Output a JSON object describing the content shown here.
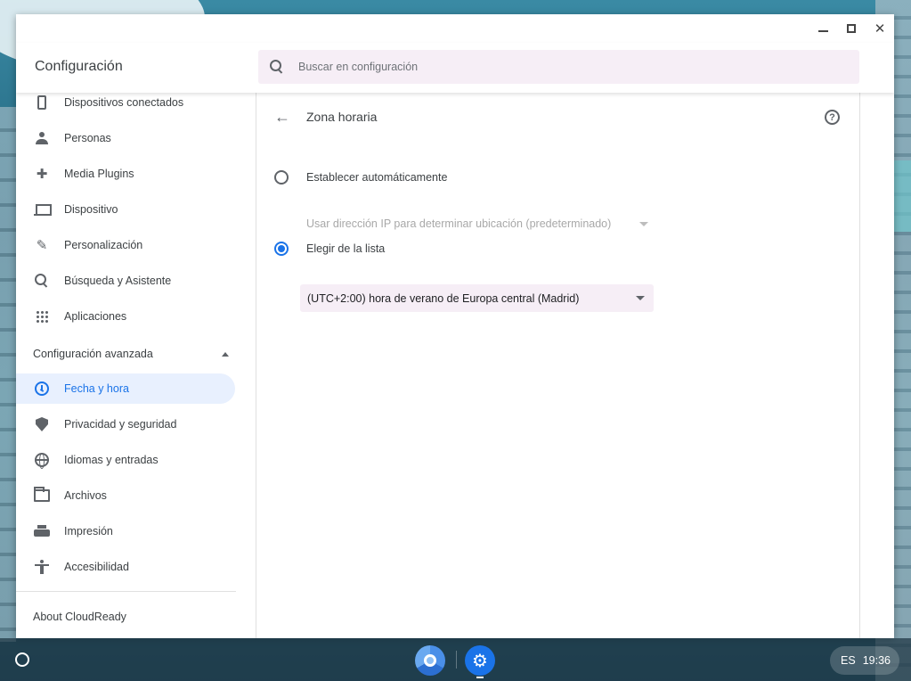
{
  "window": {
    "title": "Configuración",
    "search_placeholder": "Buscar en configuración"
  },
  "sidebar": {
    "items": [
      {
        "label": "Dispositivos conectados",
        "icon": "phone-icon"
      },
      {
        "label": "Personas",
        "icon": "person-icon"
      },
      {
        "label": "Media Plugins",
        "icon": "puzzle-icon"
      },
      {
        "label": "Dispositivo",
        "icon": "laptop-icon"
      },
      {
        "label": "Personalización",
        "icon": "brush-icon"
      },
      {
        "label": "Búsqueda y Asistente",
        "icon": "search-icon"
      },
      {
        "label": "Aplicaciones",
        "icon": "apps-grid-icon"
      }
    ],
    "advanced_label": "Configuración avanzada",
    "advanced_items": [
      {
        "label": "Fecha y hora",
        "icon": "clock-icon",
        "active": true
      },
      {
        "label": "Privacidad y seguridad",
        "icon": "shield-icon"
      },
      {
        "label": "Idiomas y entradas",
        "icon": "globe-icon"
      },
      {
        "label": "Archivos",
        "icon": "folder-icon"
      },
      {
        "label": "Impresión",
        "icon": "printer-icon"
      },
      {
        "label": "Accesibilidad",
        "icon": "accessibility-icon"
      }
    ],
    "about_label": "About CloudReady"
  },
  "main": {
    "page_title": "Zona horaria",
    "option_auto_label": "Establecer automáticamente",
    "auto_select_value": "Usar dirección IP para determinar ubicación (predeterminado)",
    "option_list_label": "Elegir de la lista",
    "timezone_value": "(UTC+2:00) hora de verano de Europa central (Madrid)",
    "selected_option": "Elegir de la lista"
  },
  "shelf": {
    "language": "ES",
    "time": "19:36"
  },
  "colors": {
    "accent": "#1a73e8",
    "active_bg": "#e8f0fe",
    "search_bg": "#f6eef6"
  }
}
